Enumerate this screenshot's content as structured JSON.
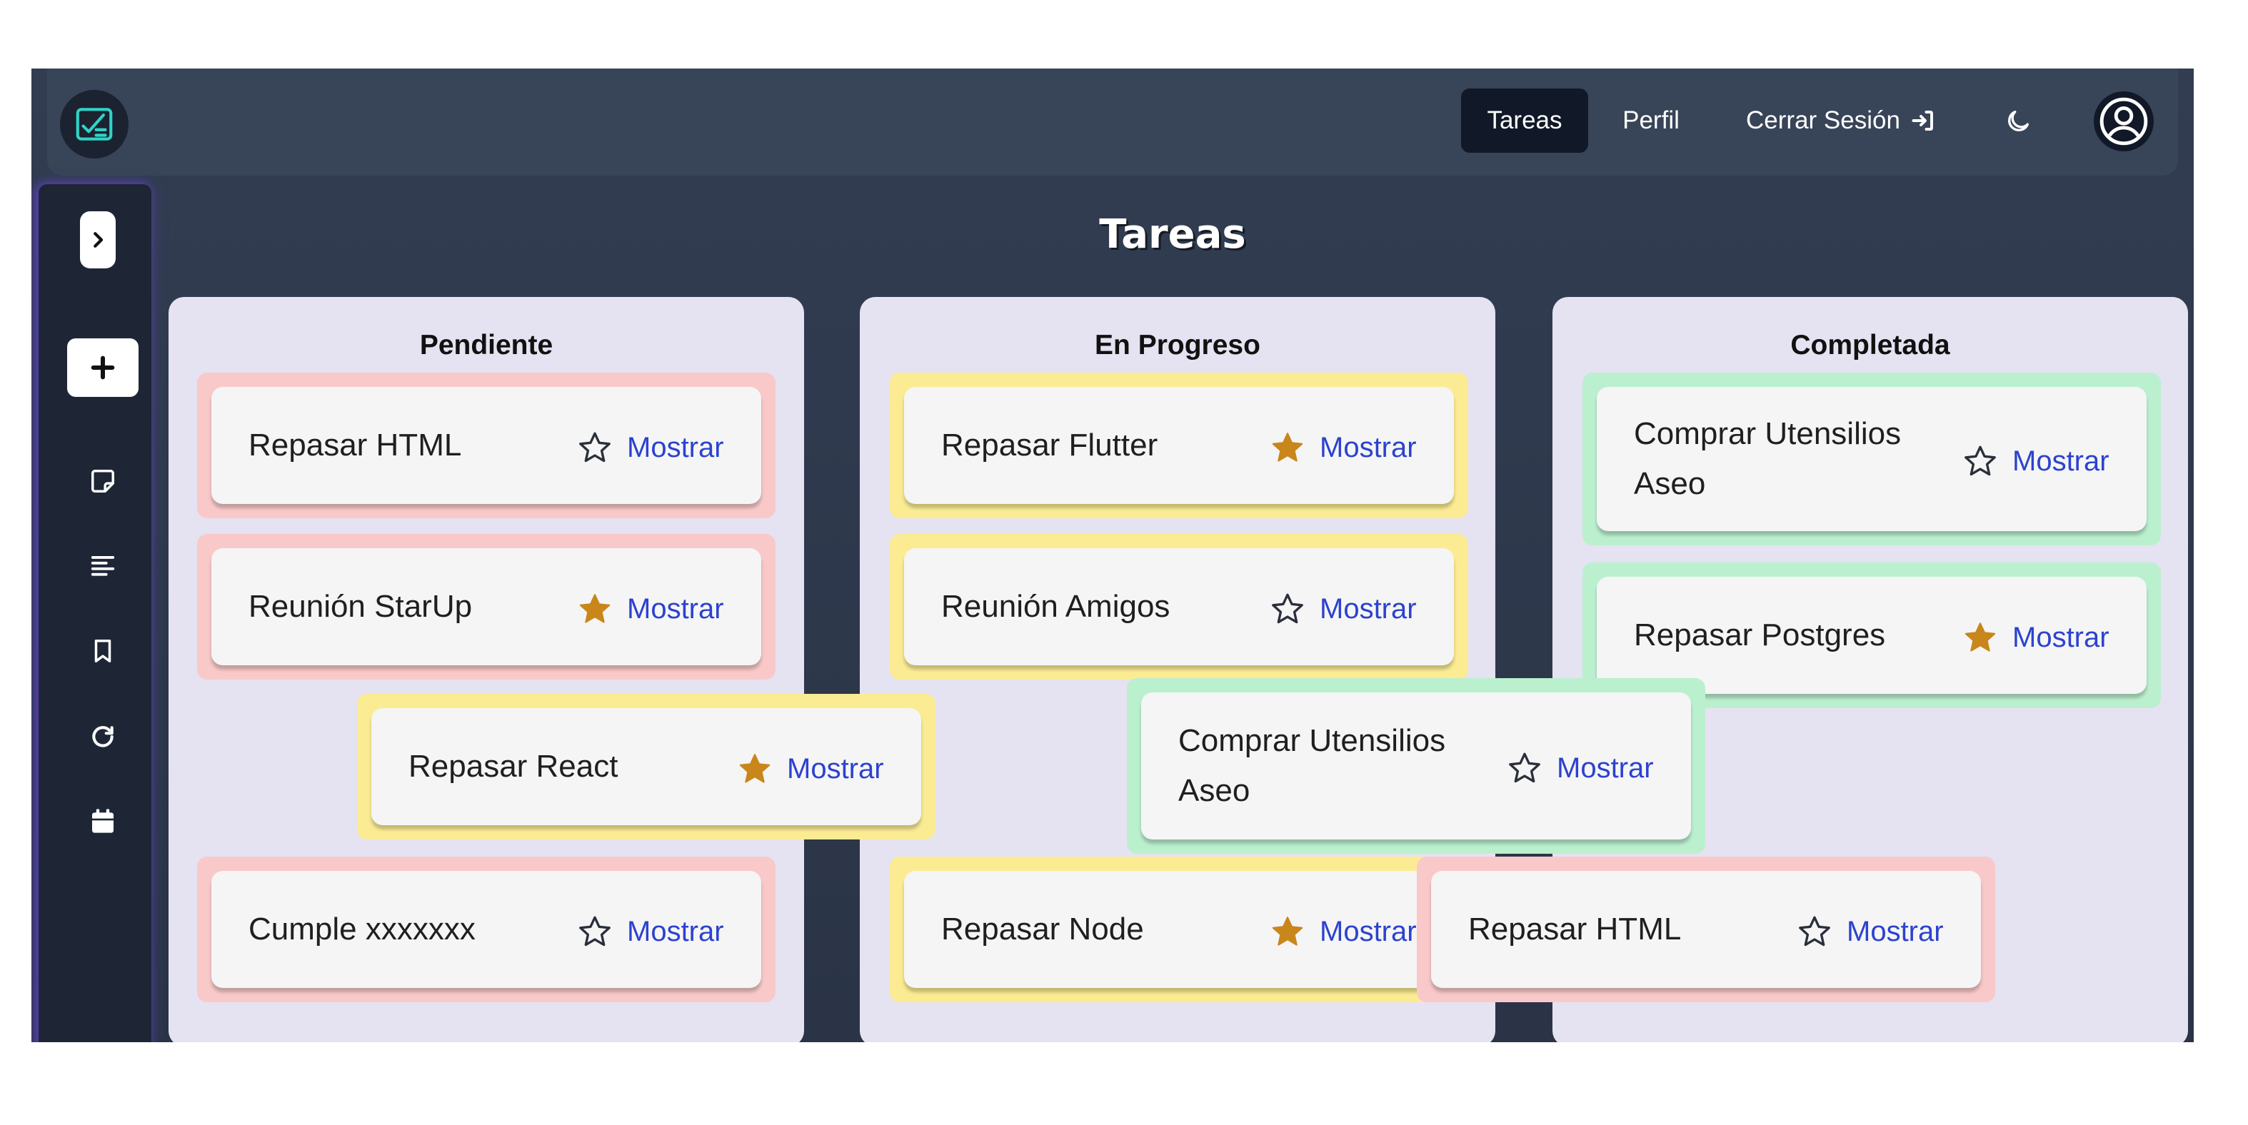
{
  "nav": {
    "tareas": "Tareas",
    "perfil": "Perfil",
    "logout": "Cerrar Sesión"
  },
  "page": {
    "title": "Tareas"
  },
  "columns": [
    {
      "title": "Pendiente"
    },
    {
      "title": "En Progreso"
    },
    {
      "title": "Completada"
    }
  ],
  "action_label": "Mostrar",
  "cards": [
    {
      "title": "Repasar HTML",
      "starred": false,
      "color": "red"
    },
    {
      "title": "Reunión StarUp",
      "starred": true,
      "color": "red"
    },
    {
      "title": "Repasar React",
      "starred": true,
      "color": "yellow"
    },
    {
      "title": "Cumple xxxxxxx",
      "starred": false,
      "color": "red"
    },
    {
      "title": "Repasar Flutter",
      "starred": true,
      "color": "yellow"
    },
    {
      "title": "Reunión Amigos",
      "starred": false,
      "color": "yellow"
    },
    {
      "title": "Comprar Utensilios Aseo",
      "starred": false,
      "color": "green"
    },
    {
      "title": "Repasar Node",
      "starred": true,
      "color": "yellow"
    },
    {
      "title": "Comprar Utensilios Aseo",
      "starred": false,
      "color": "green"
    },
    {
      "title": "Repasar Postgres",
      "starred": true,
      "color": "green"
    },
    {
      "title": "Repasar HTML",
      "starred": false,
      "color": "red"
    }
  ],
  "colors": {
    "card_red": "#f9c9c9",
    "card_yellow": "#fbec93",
    "card_green": "#bbf0cf",
    "star_filled": "#c8861b",
    "link": "#2c42cf",
    "column_bg": "#e5e2f1"
  },
  "icons": {
    "logo": "task-check-icon",
    "theme": "moon-icon",
    "profile": "user-circle-icon",
    "sidebar": [
      "chevron-right-icon",
      "plus-icon",
      "sticky-note-icon",
      "align-left-icon",
      "bookmark-icon",
      "refresh-icon",
      "calendar-icon"
    ]
  }
}
